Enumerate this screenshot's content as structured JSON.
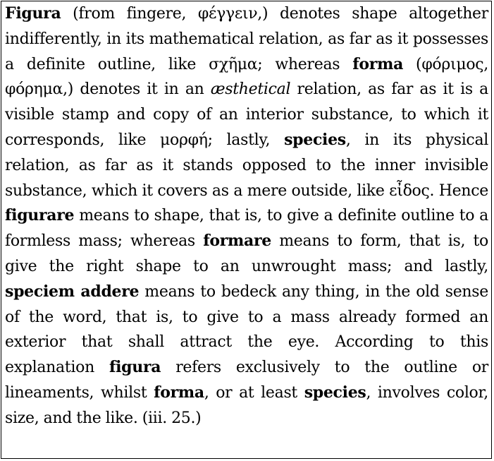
{
  "paragraph": {
    "p1_b": "Figura",
    "p1": " (from fingere, φέγγειν,) denotes shape altogether indifferently, in its mathematical relation, as far as it possesses a definite outline, like σχῆμα; whereas ",
    "p2_b": "forma",
    "p2a": " (φόριμος, φόρημα,) denotes it in an ",
    "p2_i": "æsthetical",
    "p2b": " relation, as far as it is a visible stamp and copy of an interior substance, to which it corresponds, like μορφή; lastly, ",
    "p3_b": "species",
    "p3": ", in its physical relation, as far as it stands opposed to the inner invisible substance, which it covers as a mere outside, like εἶδος. Hence ",
    "p4_b": "figurare",
    "p4": " means to shape, that is, to give a definite outline to a formless mass; whereas ",
    "p5_b": "formare",
    "p5": " means to form, that is, to give the right shape to an unwrought mass; and lastly, ",
    "p6_b": "speciem addere",
    "p6": " means to bedeck any thing, in the old sense of the word, that is, to give to a mass already formed an exterior that shall attract the eye. According to this explanation ",
    "p7_b": "figura",
    "p7": " refers exclusively to the outline or lineaments, whilst ",
    "p8_b": "forma",
    "p8": ", or at least ",
    "p9_b": "species",
    "p9": ", involves color, size, and the like. (iii. 25.)"
  }
}
